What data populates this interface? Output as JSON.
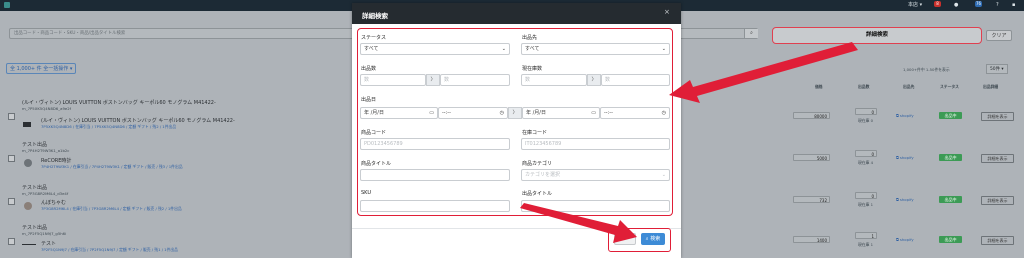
{
  "topbar": {
    "store": "本店",
    "badge_red": "8",
    "badge_blue": "76"
  },
  "background": {
    "search_placeholder": "出品コード・商品コード・SKU・商品/出品タイトル検索",
    "adv_search_label": "詳細検索",
    "clear_label": "クリア",
    "bulk_label": "全 1,000+ 件 全一括操作",
    "pager_text": "1,000+件中 1-50件を表示",
    "per_page": "50件",
    "col_price": "価格",
    "col_qty": "出品数",
    "col_dest": "出品先",
    "col_status": "ステータス",
    "col_detail": "出品詳細",
    "rows": [
      {
        "title": "(ルイ・ヴィトン) LOUIS VUITTON ボストンバッグ キーポル60 モノグラム M41422-",
        "code": "m_7P5XK5Q4N8D6_a9e2f",
        "sub": "(ルイ・ヴィトン) LOUIS VUITTON ボストンバッグ キーポル60 モノグラム M41422-",
        "meta": "7P5XK5Q4N8D6 / 在庫引当 / 7P5XK5Q4N8D6 / 定額 ギフト / 残2 / 1件出品",
        "price": "80000",
        "qty": "0",
        "qty_sub": "現在庫 0",
        "dest": "shopify",
        "status": "出品中",
        "detail": "詳細を表示"
      },
      {
        "title": "テスト出品",
        "code": "m_7P4H2T9W3K1_a1b2c",
        "sub": "ReCORE時計",
        "meta": "7P4H2T9W3K1 / 在庫引当 / 7P4H2T9W3K1 / 定額 ギフト / 販売 / 残3 / 1件出品",
        "price": "5000",
        "qty": "0",
        "qty_sub": "現在庫 4",
        "dest": "shopify",
        "status": "出品中",
        "detail": "詳細を表示"
      },
      {
        "title": "テスト出品",
        "code": "m_7P3G8R2M6L4_d3e4f",
        "sub": "んぼちゃむ",
        "meta": "7P3G8R2M6L4 / 在庫引当 / 7P3G8R2M6L4 / 定額 ギフト / 販売 / 残2 / 1件出品",
        "price": "732",
        "qty": "0",
        "qty_sub": "現在庫 1",
        "dest": "shopify",
        "status": "出品中",
        "detail": "詳細を表示"
      },
      {
        "title": "テスト出品",
        "code": "m_7P2F5Q1N9J7_g5h6i",
        "sub": "テスト",
        "meta": "7P2F5Q1N9J7 / 在庫引当 / 7P2F5Q1N9J7 / 定額 ギフト / 販売 / 残1 / 1件出品",
        "price": "1400",
        "qty": "1",
        "qty_sub": "現在庫 1",
        "dest": "shopify",
        "status": "出品中",
        "detail": "詳細を表示"
      }
    ]
  },
  "modal": {
    "title": "詳細検索",
    "close": "×",
    "status_label": "ステータス",
    "status_value": "すべて",
    "dest_label": "出品先",
    "dest_value": "すべて",
    "qty_label": "出品数",
    "qty_from_placeholder": "数",
    "qty_to_placeholder": "数",
    "stock_label": "現在庫数",
    "stock_from_placeholder": "数",
    "stock_to_placeholder": "数",
    "range_sep": "〉",
    "date_label": "出品日",
    "date_placeholder": "年 /月/日",
    "time_placeholder": "--:--",
    "product_code_label": "商品コード",
    "product_code_placeholder": "PD0123456789",
    "stock_code_label": "在庫コード",
    "stock_code_placeholder": "IT0123456789",
    "product_title_label": "商品タイトル",
    "category_label": "商品カテゴリ",
    "category_placeholder": "カテゴリを選択",
    "sku_label": "SKU",
    "listing_title_label": "出品タイトル",
    "search_button": "検索"
  },
  "colors": {
    "highlight": "#e01e37",
    "primary": "#3d8bd6",
    "status_green": "#3c9b55",
    "header_dark": "#252b30"
  }
}
